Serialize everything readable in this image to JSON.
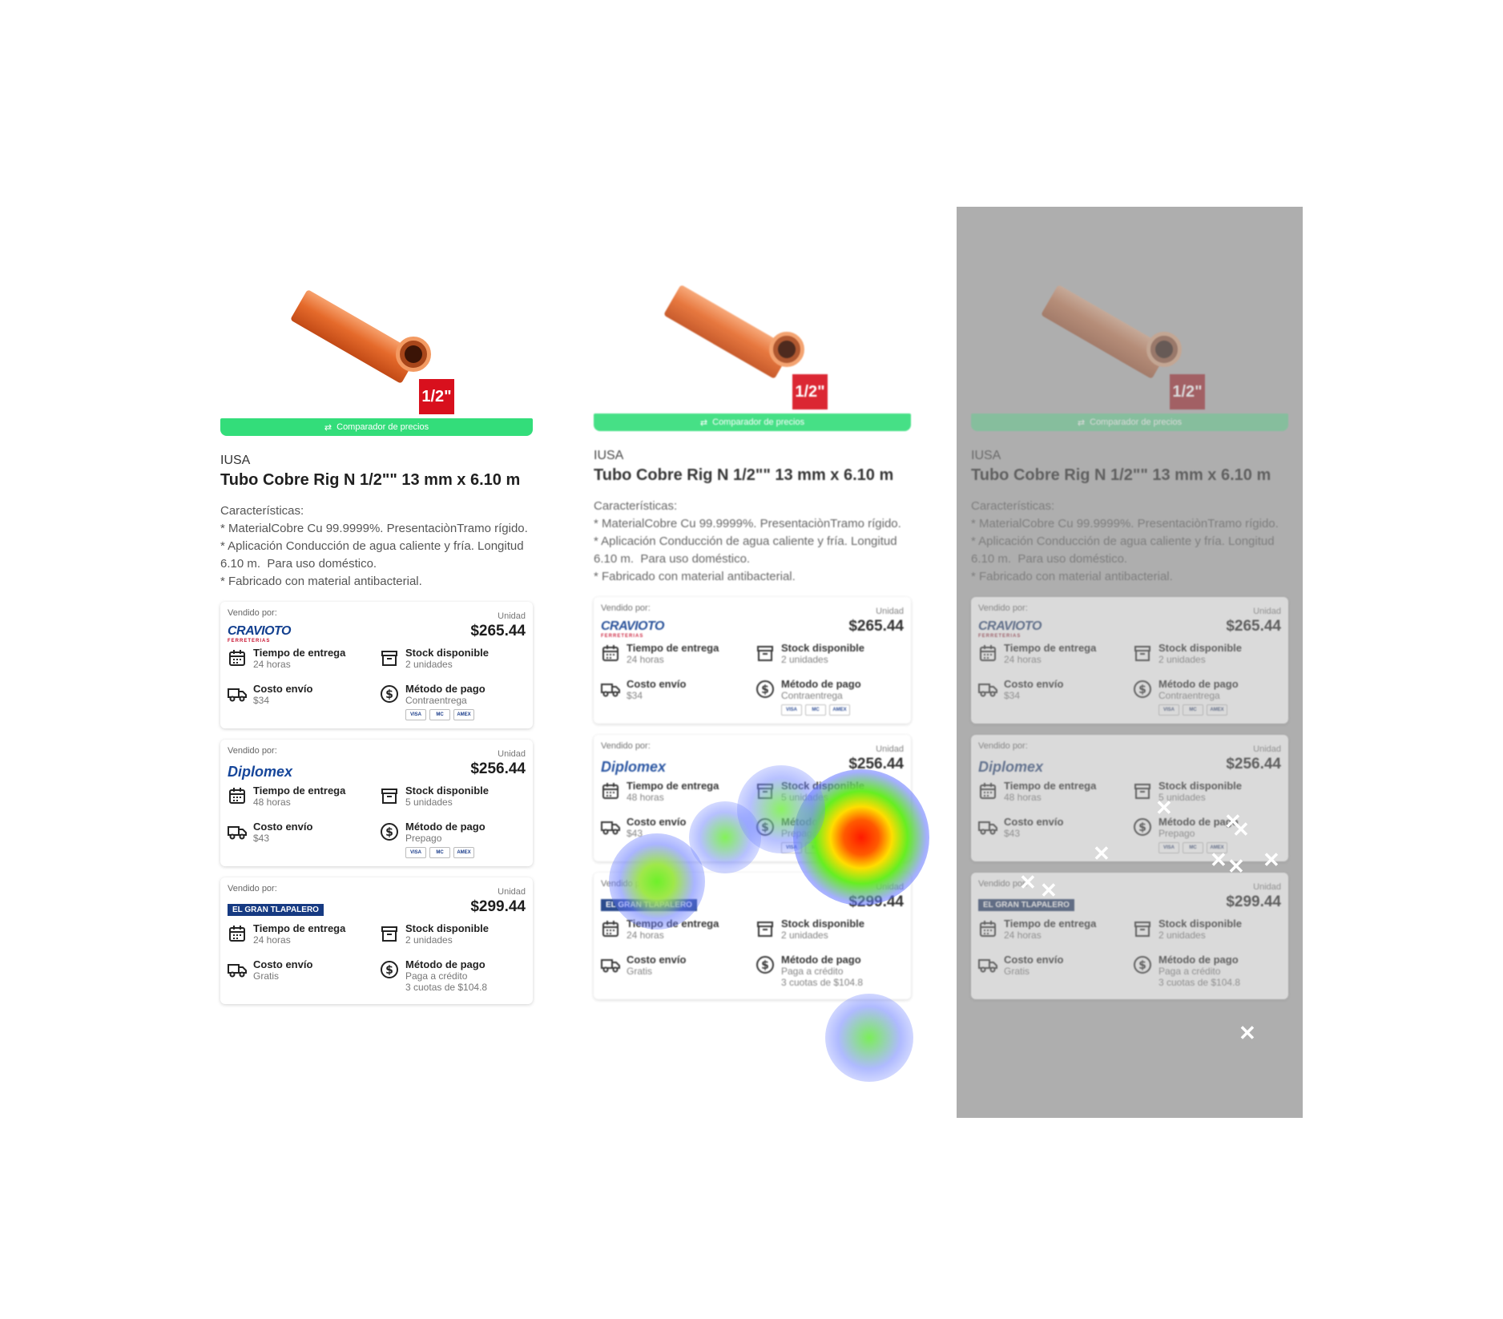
{
  "product": {
    "size_badge": "1/2\"",
    "compare_label": "Comparador de precios",
    "brand": "IUSA",
    "title": "Tubo Cobre Rig N 1/2\"\" 13 mm x 6.10 m",
    "desc_heading": "Características:",
    "desc_lines": [
      "* MaterialCobre Cu 99.9999%. PresentaciònTramo rígido.",
      "* Aplicación Conducción de agua caliente y fría. Longitud 6.10 m.  Para uso doméstico.",
      "* Fabricado con material antibacterial."
    ]
  },
  "offers": [
    {
      "sold_by": "Vendido por:",
      "seller": "CRAVIOTO",
      "seller_sub": "FERRETERIAS",
      "unit": "Unidad",
      "price": "$265.44",
      "delivery_label": "Tiempo de entrega",
      "delivery_value": "24 horas",
      "stock_label": "Stock disponible",
      "stock_value": "2 unidades",
      "shipping_label": "Costo envío",
      "shipping_value": "$34",
      "payment_label": "Método de pago",
      "payment_value": "Contraentrega",
      "payment_extra": ""
    },
    {
      "sold_by": "Vendido por:",
      "seller": "Diplomex",
      "seller_sub": "",
      "unit": "Unidad",
      "price": "$256.44",
      "delivery_label": "Tiempo de entrega",
      "delivery_value": "48 horas",
      "stock_label": "Stock disponible",
      "stock_value": "5 unidades",
      "shipping_label": "Costo envío",
      "shipping_value": "$43",
      "payment_label": "Método de pago",
      "payment_value": "Prepago",
      "payment_extra": ""
    },
    {
      "sold_by": "Vendido por:",
      "seller": "EL GRAN TLAPALERO",
      "seller_sub": "",
      "unit": "Unidad",
      "price": "$299.44",
      "delivery_label": "Tiempo de entrega",
      "delivery_value": "24 horas",
      "stock_label": "Stock disponible",
      "stock_value": "2 unidades",
      "shipping_label": "Costo envío",
      "shipping_value": "Gratis",
      "payment_label": "Método de pago",
      "payment_value": "Paga a crédito",
      "payment_extra": "3 cuotas de $104.8"
    }
  ],
  "payment_badges": [
    "VISA",
    "MC",
    "AMEX"
  ],
  "colors": {
    "accent_green": "#33dd7a",
    "badge_red": "#d8101d",
    "shade_gray": "#aeaeae"
  }
}
